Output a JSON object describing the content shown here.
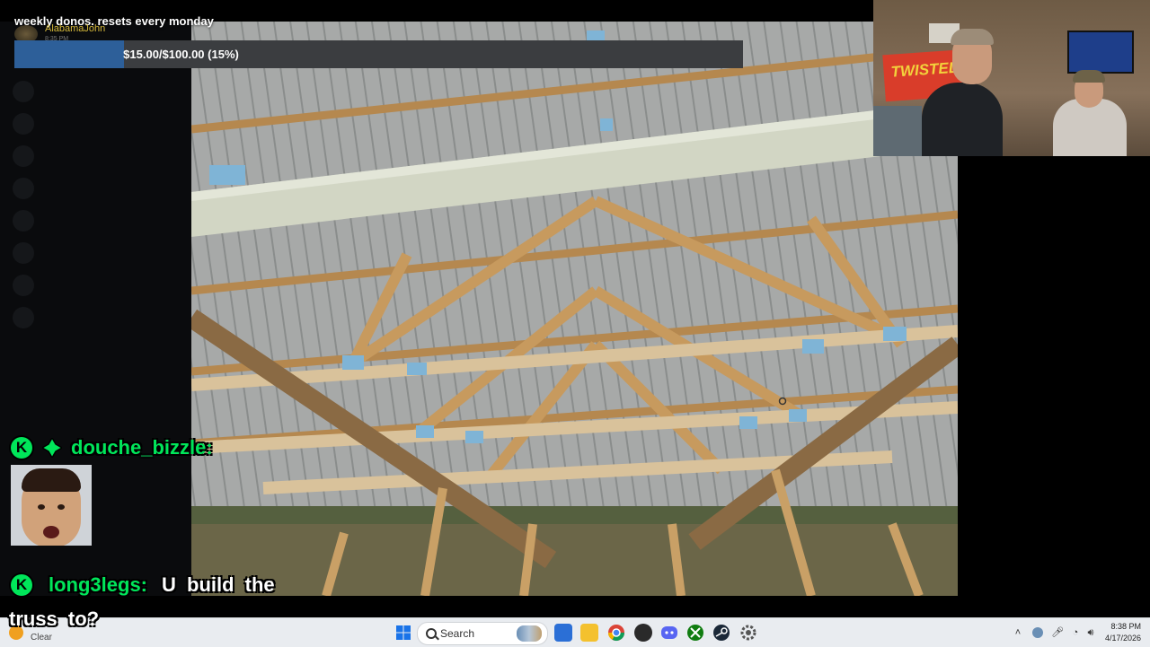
{
  "donation_goal": {
    "title": "weekly donos. resets every monday",
    "recent_donor": "AlabamaJohn",
    "recent_donor_time": "8:35 PM",
    "progress_text": "$15.00/$100.00 (15%)",
    "progress_fraction": 0.15,
    "fill_color": "#2d5f99"
  },
  "chat": {
    "messages": [
      {
        "badges": [
          "k-badge",
          "diamond-badge"
        ],
        "username": "douche_bizzle:",
        "text": "",
        "emote": "shouting-face-emote"
      },
      {
        "badges": [
          "k-badge"
        ],
        "username": "long3legs:",
        "text_line1": "U build the",
        "text_line2": "truss to?"
      }
    ],
    "name_color": "#00e65a"
  },
  "taskbar": {
    "weather_label": "Clear",
    "search_placeholder": "Search",
    "pinned_icons": [
      "windows-start-icon",
      "search-icon",
      "mixer-app-icon",
      "file-explorer-icon",
      "chrome-icon",
      "media-player-icon",
      "discord-icon",
      "xbox-icon",
      "steam-icon",
      "settings-icon"
    ],
    "tray_icons": [
      "chevron-up-icon",
      "network-icon",
      "microphone-icon",
      "wifi-icon",
      "volume-icon"
    ],
    "time": "8:38 PM",
    "date": "4/17/2026"
  }
}
